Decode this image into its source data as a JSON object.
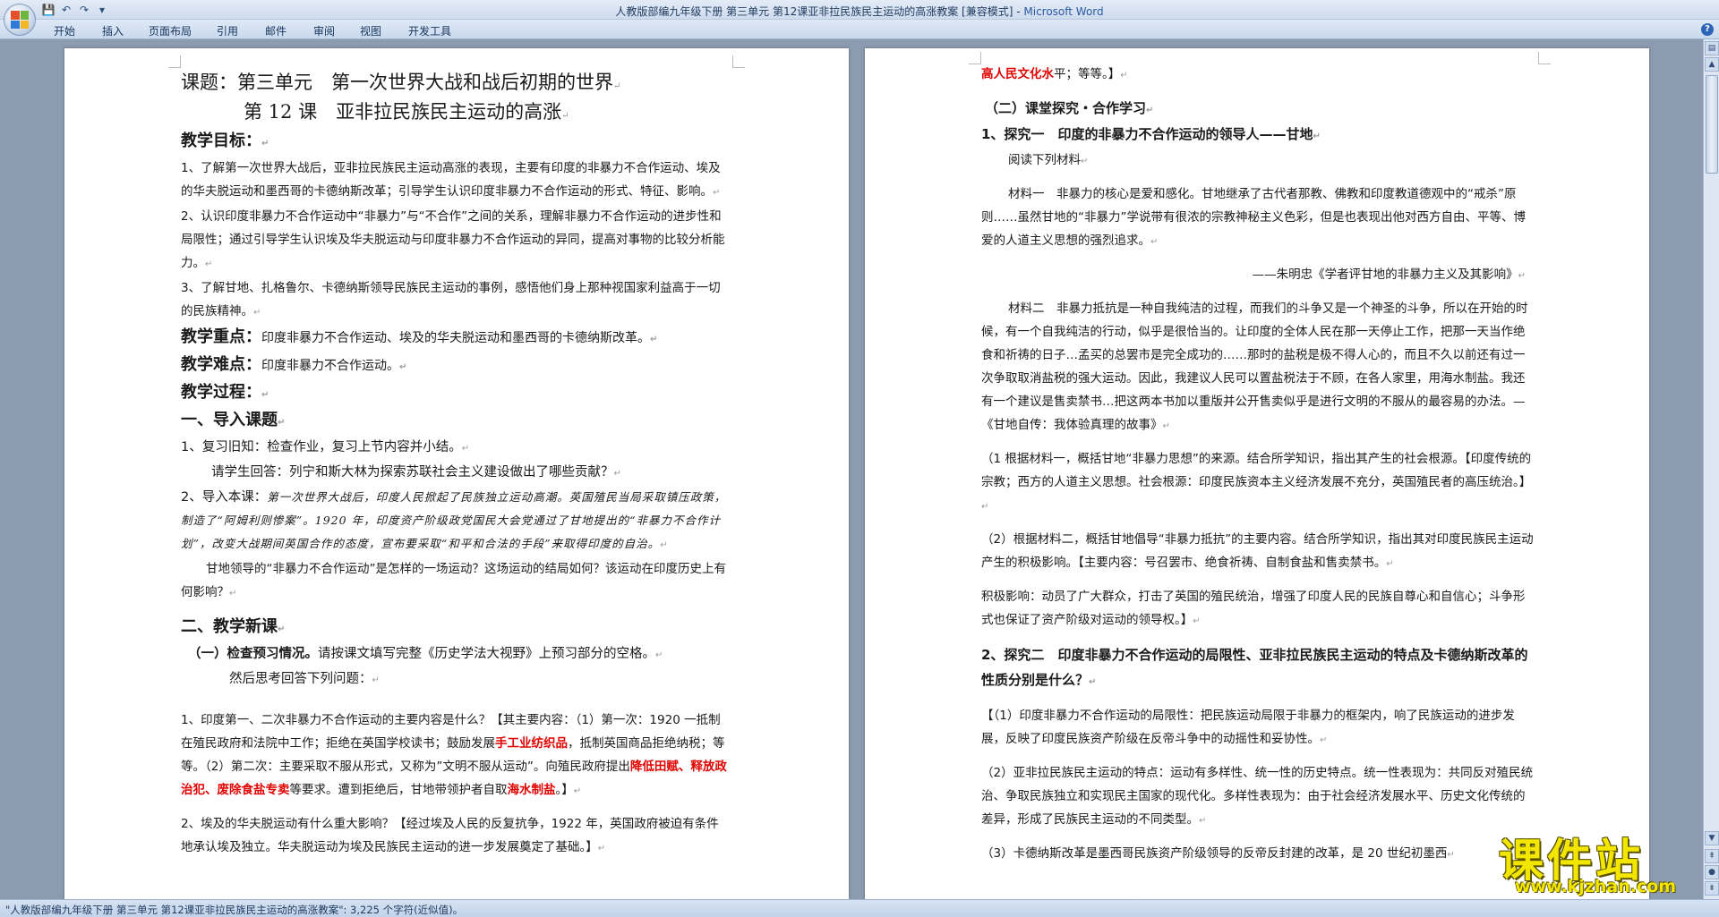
{
  "window": {
    "title_doc": "人教版部编九年级下册 第三单元 第12课亚非拉民族民主运动的高涨教案 [兼容模式] - ",
    "title_app": "Microsoft Word"
  },
  "qat": {
    "save_icon": "💾",
    "undo_icon": "↶",
    "redo_icon": "↷",
    "more_icon": "▾"
  },
  "ribbon": {
    "tabs": [
      "开始",
      "插入",
      "页面布局",
      "引用",
      "邮件",
      "审阅",
      "视图",
      "开发工具"
    ],
    "help": "?"
  },
  "page1": {
    "title": "课题：第三单元　第一次世界大战和战后初期的世界",
    "subtitle": "第 12 课　亚非拉民族民主运动的高涨",
    "goals_heading": "教学目标：",
    "goal1": "1、了解第一次世界大战后，亚非拉民族民主运动高涨的表现，主要有印度的非暴力不合作运动、埃及的华夫脱运动和墨西哥的卡德纳斯改革；引导学生认识印度非暴力不合作运动的形式、特征、影响。",
    "goal2": "2、认识印度非暴力不合作运动中“非暴力”与“不合作”之间的关系，理解非暴力不合作运动的进步性和局限性；通过引导学生认识埃及华夫脱运动与印度非暴力不合作运动的异同，提高对事物的比较分析能力。",
    "goal3": "3、了解甘地、扎格鲁尔、卡德纳斯领导民族民主运动的事例，感悟他们身上那种视国家利益高于一切的民族精神。",
    "key_label": "教学重点：",
    "key_text": "印度非暴力不合作运动、埃及的华夫脱运动和墨西哥的卡德纳斯改革。",
    "diff_label": "教学难点：",
    "diff_text": "印度非暴力不合作运动。",
    "process": "教学过程：",
    "sec1": "一、导入课题",
    "review1": "1、复习旧知：检查作业，复习上节内容并小结。",
    "review2": "请学生回答：列宁和斯大林为探索苏联社会主义建设做出了哪些贡献？",
    "intro_label": "2、导入本课：",
    "intro_italic": "第一次世界大战后，印度人民掀起了民族独立运动高潮。英国殖民当局采取镇压政策，制造了“阿姆利则惨案”。1920 年，印度资产阶级政党国民大会党通过了甘地提出的“非暴力不合作计划”，改变大战期间英国合作的态度，宣布要采取“和平和合法的手段”来取得印度的自治。",
    "intro_q": "甘地领导的“非暴力不合作运动”是怎样的一场运动？这场运动的结局如何？该运动在印度历史上有何影响？",
    "sec2": "二、教学新课",
    "preview_bold": "（一）检查预习情况。",
    "preview_text": "请按课文填写完整《历史学法大视野》上预习部分的空格。",
    "preview_then": "然后思考回答下列问题：",
    "q1_a": "1、印度第一、二次非暴力不合作运动的主要内容是什么？【其主要内容：（1）第一次：1920 一抵制在殖民政府和法院中工作；拒绝在英国学校读书；鼓励发展",
    "q1_red1": "手工业纺织品",
    "q1_b": "，抵制英国商品拒绝纳税；等等。（2）第二次：主要采取不服从形式，又称为”文明不服从运动”。向殖民政府提出",
    "q1_red2": "降低田赋",
    "q1_sep1": "、",
    "q1_red3": "释放政治犯",
    "q1_sep2": "、",
    "q1_red4": "废除食盐专卖",
    "q1_c": "等要求。遭到拒绝后，甘地带领护者自取",
    "q1_red5": "海水制盐",
    "q1_d": "。】",
    "q2": "2、埃及的华夫脱运动有什么重大影响？【经过埃及人民的反复抗争，1922 年，英国政府被迫有条件地承认埃及独立。华夫脱运动为埃及民族民主运动的进一步发展奠定了基础。】"
  },
  "page2": {
    "top_red": "高人民文化水",
    "top_rest": "平；等等。】",
    "sec_explore": "（二）课堂探究・合作学习",
    "explore1": "1、探究一　印度的非暴力不合作运动的领导人——甘地",
    "read": "阅读下列材料",
    "m1": "材料一　非暴力的核心是爱和感化。甘地继承了古代者那教、佛教和印度教道德观中的“戒杀”原则……虽然甘地的“非暴力”学说带有很浓的宗教神秘主义色彩，但是也表现出他对西方自由、平等、博爱的人道主义思想的强烈追求。",
    "m1_src": "——朱明忠《学者评甘地的非暴力主义及其影响》",
    "m2": "材料二　非暴力抵抗是一种自我纯洁的过程，而我们的斗争又是一个神圣的斗争，所以在开始的时候，有一个自我纯洁的行动，似乎是很恰当的。让印度的全体人民在那一天停止工作，把那一天当作绝食和祈祷的日子…孟买的总罢市是完全成功的……那时的盐税是极不得人心的，而且不久以前还有过一次争取取消盐税的强大运动。因此，我建议人民可以置盐税法于不顾，在各人家里，用海水制盐。我还有一个建议是售卖禁书…把这两本书加以重版并公开售卖似乎是进行文明的不服从的最容易的办法。—《甘地自传：我体验真理的故事》",
    "a1": "（1 根据材料一，概括甘地“非暴力思想”的来源。结合所学知识，指出其产生的社会根源。【印度传统的宗教；西方的人道主义思想。社会根源：印度民族资本主义经济发展不充分，英国殖民者的高压统治。】",
    "a2": "（2）根据材料二，概括甘地倡导“非暴力抵抗”的主要内容。结合所学知识，指出其对印度民族民主运动产生的积极影响。【主要内容：号召罢市、绝食祈祷、自制食盐和售卖禁书。",
    "a2_pos": "积极影响：动员了广大群众，打击了英国的殖民统治，增强了印度人民的民族自尊心和自信心；斗争形式也保证了资产阶级对运动的领导权。】",
    "explore2": "2、探究二　印度非暴力不合作运动的局限性、亚非拉民族民主运动的特点及卡德纳斯改革的性质分别是什么？",
    "b1": "【（1）印度非暴力不合作运动的局限性：把民族运动局限于非暴力的框架内，响了民族运动的进步发展，反映了印度民族资产阶级在反帝斗争中的动摇性和妥协性。",
    "b2": "（2）亚非拉民族民主运动的特点：运动有多样性、统一性的历史特点。统一性表现为：共同反对殖民统治、争取民族独立和实现民主国家的现代化。多样性表现为：由于社会经济发展水平、历史文化传统的差异，形成了民族民主运动的不同类型。",
    "b3": "（3）卡德纳斯改革是墨西哥民族资产阶级领导的反帝反封建的改革，是 20 世纪初墨西"
  },
  "status": {
    "text": "\"人教版部编九年级下册 第三单元 第12课亚非拉民族民主运动的高涨教案\": 3,225 个字符(近似值)。"
  },
  "watermark": {
    "title": "课件站",
    "url": "www.kjzhan.com"
  },
  "para_mark": "↵"
}
